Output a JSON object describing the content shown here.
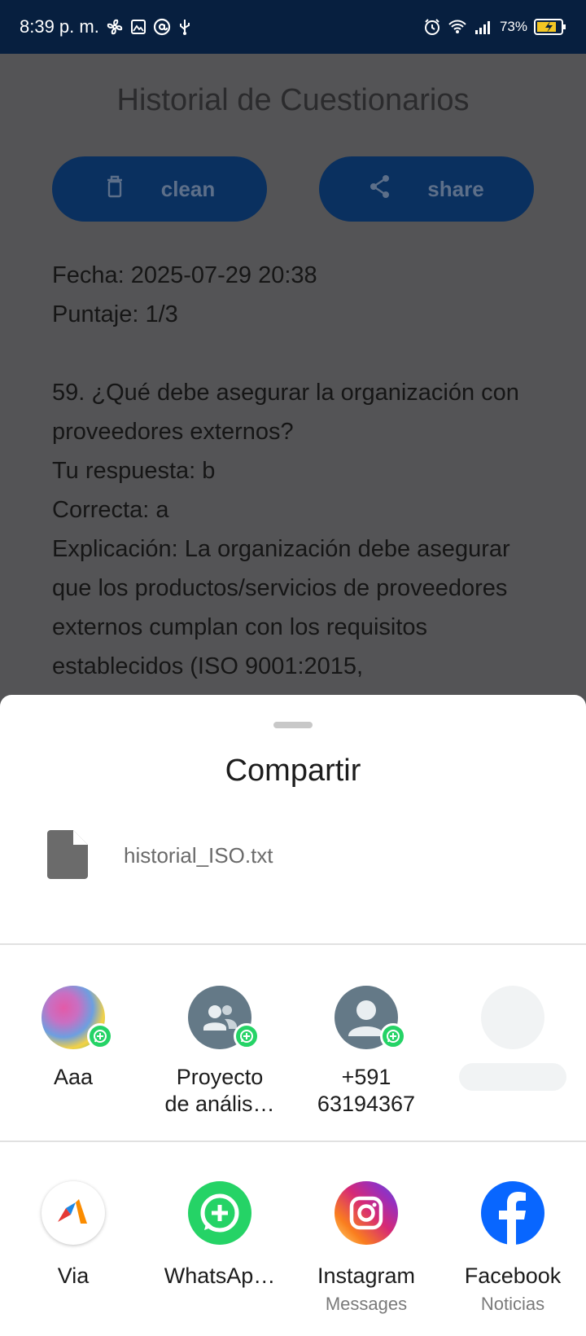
{
  "status_bar": {
    "time": "8:39 p. m.",
    "battery": "73%",
    "icons": [
      "fan-icon",
      "image-icon",
      "at-icon",
      "usb-icon",
      "alarm-icon",
      "wifi-icon",
      "signal-icon",
      "battery-charging-icon"
    ]
  },
  "app": {
    "title": "Historial de Cuestionarios",
    "clean_label": "clean",
    "share_label": "share",
    "history": {
      "date": "Fecha: 2025-07-29 20:38",
      "score": "Puntaje: 1/3",
      "question": "59. ¿Qué debe asegurar la organización con proveedores externos?",
      "your_answer": "Tu respuesta: b",
      "correct": "Correcta: a",
      "explanation": "Explicación: La organización debe asegurar que los productos/servicios de proveedores externos cumplan con los requisitos establecidos (ISO 9001:2015,"
    }
  },
  "share_sheet": {
    "title": "Compartir",
    "file_name": "historial_ISO.txt",
    "direct_share": [
      {
        "name": "Aaa",
        "name2": ""
      },
      {
        "name": "Proyecto",
        "name2": "de anális…"
      },
      {
        "name": "+591",
        "name2": "63194367"
      }
    ],
    "apps": [
      {
        "name": "Via",
        "sub": ""
      },
      {
        "name": "WhatsAp…",
        "sub": ""
      },
      {
        "name": "Instagram",
        "sub": "Messages"
      },
      {
        "name": "Facebook",
        "sub": "Noticias"
      }
    ],
    "colors": {
      "whatsapp": "#25d366",
      "facebook": "#0866ff",
      "sheet_bg": "#ffffff",
      "scrim": "#545456"
    }
  }
}
